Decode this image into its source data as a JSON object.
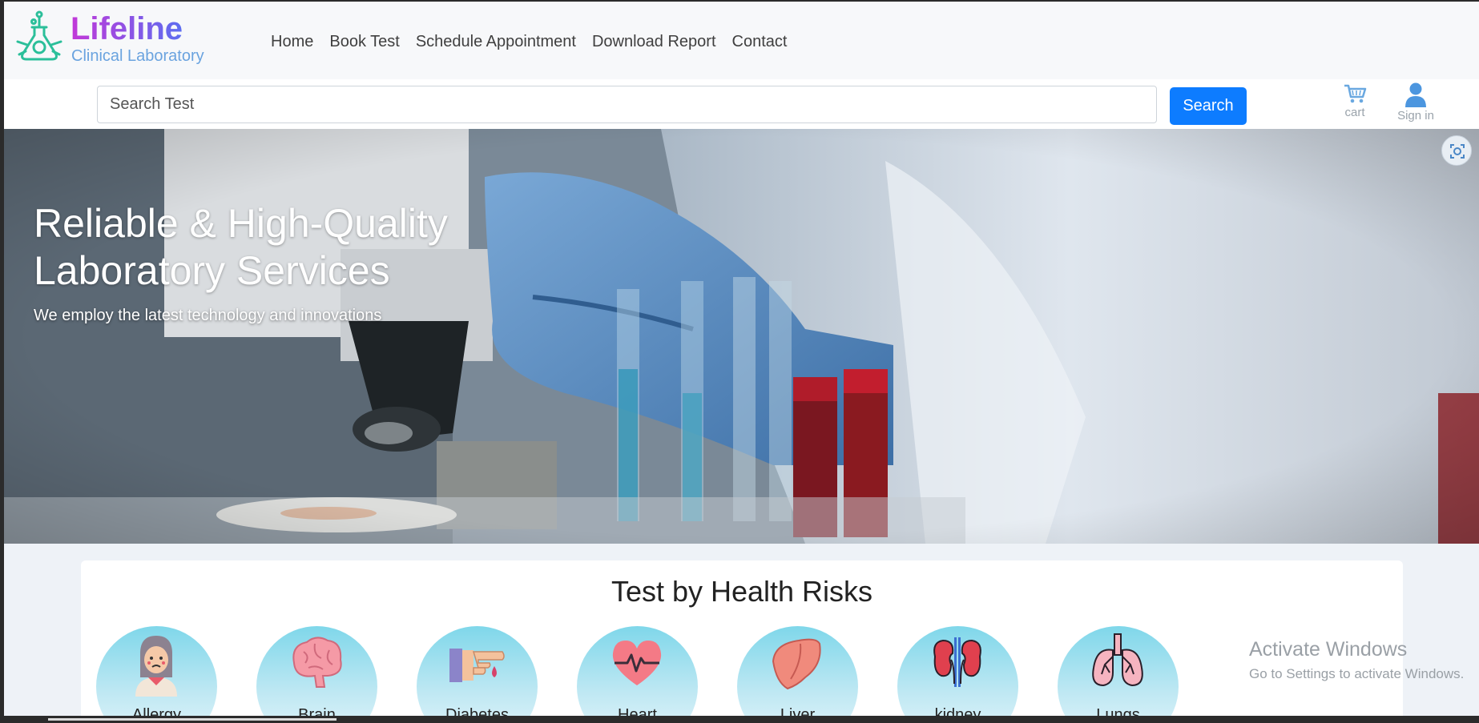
{
  "brand": {
    "name": "Lifeline",
    "subtitle": "Clinical Laboratory",
    "logo_icon": "lab-flask-icon"
  },
  "nav": {
    "items": [
      {
        "label": "Home"
      },
      {
        "label": "Book Test"
      },
      {
        "label": "Schedule Appointment"
      },
      {
        "label": "Download Report"
      },
      {
        "label": "Contact"
      }
    ]
  },
  "search": {
    "placeholder": "Search Test",
    "button_label": "Search",
    "button_color": "#0d7cff"
  },
  "toolbar": {
    "cart_label": "cart",
    "cart_icon": "cart-icon",
    "signin_label": "Sign in",
    "signin_icon": "user-icon"
  },
  "hero": {
    "title_line1": "Reliable & High-Quality",
    "title_line2": "Laboratory Services",
    "subtitle": "We employ the latest technology and innovations"
  },
  "health_risks": {
    "title": "Test by Health Risks",
    "items": [
      {
        "label": "Allergy",
        "icon": "allergy-face-icon"
      },
      {
        "label": "Brain",
        "icon": "brain-icon"
      },
      {
        "label": "Diabetes",
        "icon": "glucose-test-icon"
      },
      {
        "label": "Heart",
        "icon": "heart-pulse-icon"
      },
      {
        "label": "Liver",
        "icon": "liver-icon"
      },
      {
        "label": "kidney",
        "icon": "kidney-icon"
      },
      {
        "label": "Lungs",
        "icon": "lungs-icon"
      }
    ]
  },
  "watermark": {
    "line1": "Activate Windows",
    "line2": "Go to Settings to activate Windows."
  }
}
